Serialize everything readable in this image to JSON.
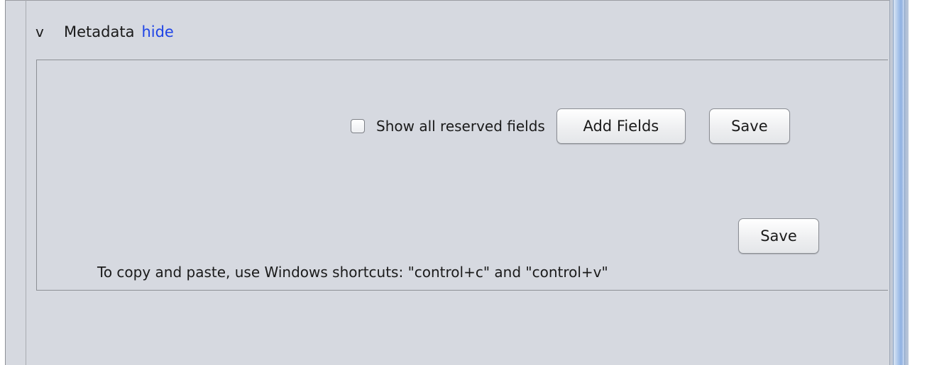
{
  "section": {
    "toggle_symbol": "v",
    "title": "Metadata",
    "hide_link": "hide"
  },
  "toolbar": {
    "checkbox_label": "Show all reserved fields",
    "checkbox_checked": false,
    "add_fields_label": "Add Fields",
    "save_label": "Save"
  },
  "footer": {
    "save_label": "Save",
    "hint": "To copy and paste, use Windows shortcuts: \"control+c\" and \"control+v\""
  },
  "colors": {
    "panel_bg": "#d6d9e0",
    "link": "#1f44e6",
    "scrollbar_thumb": "#a8c4ea"
  }
}
